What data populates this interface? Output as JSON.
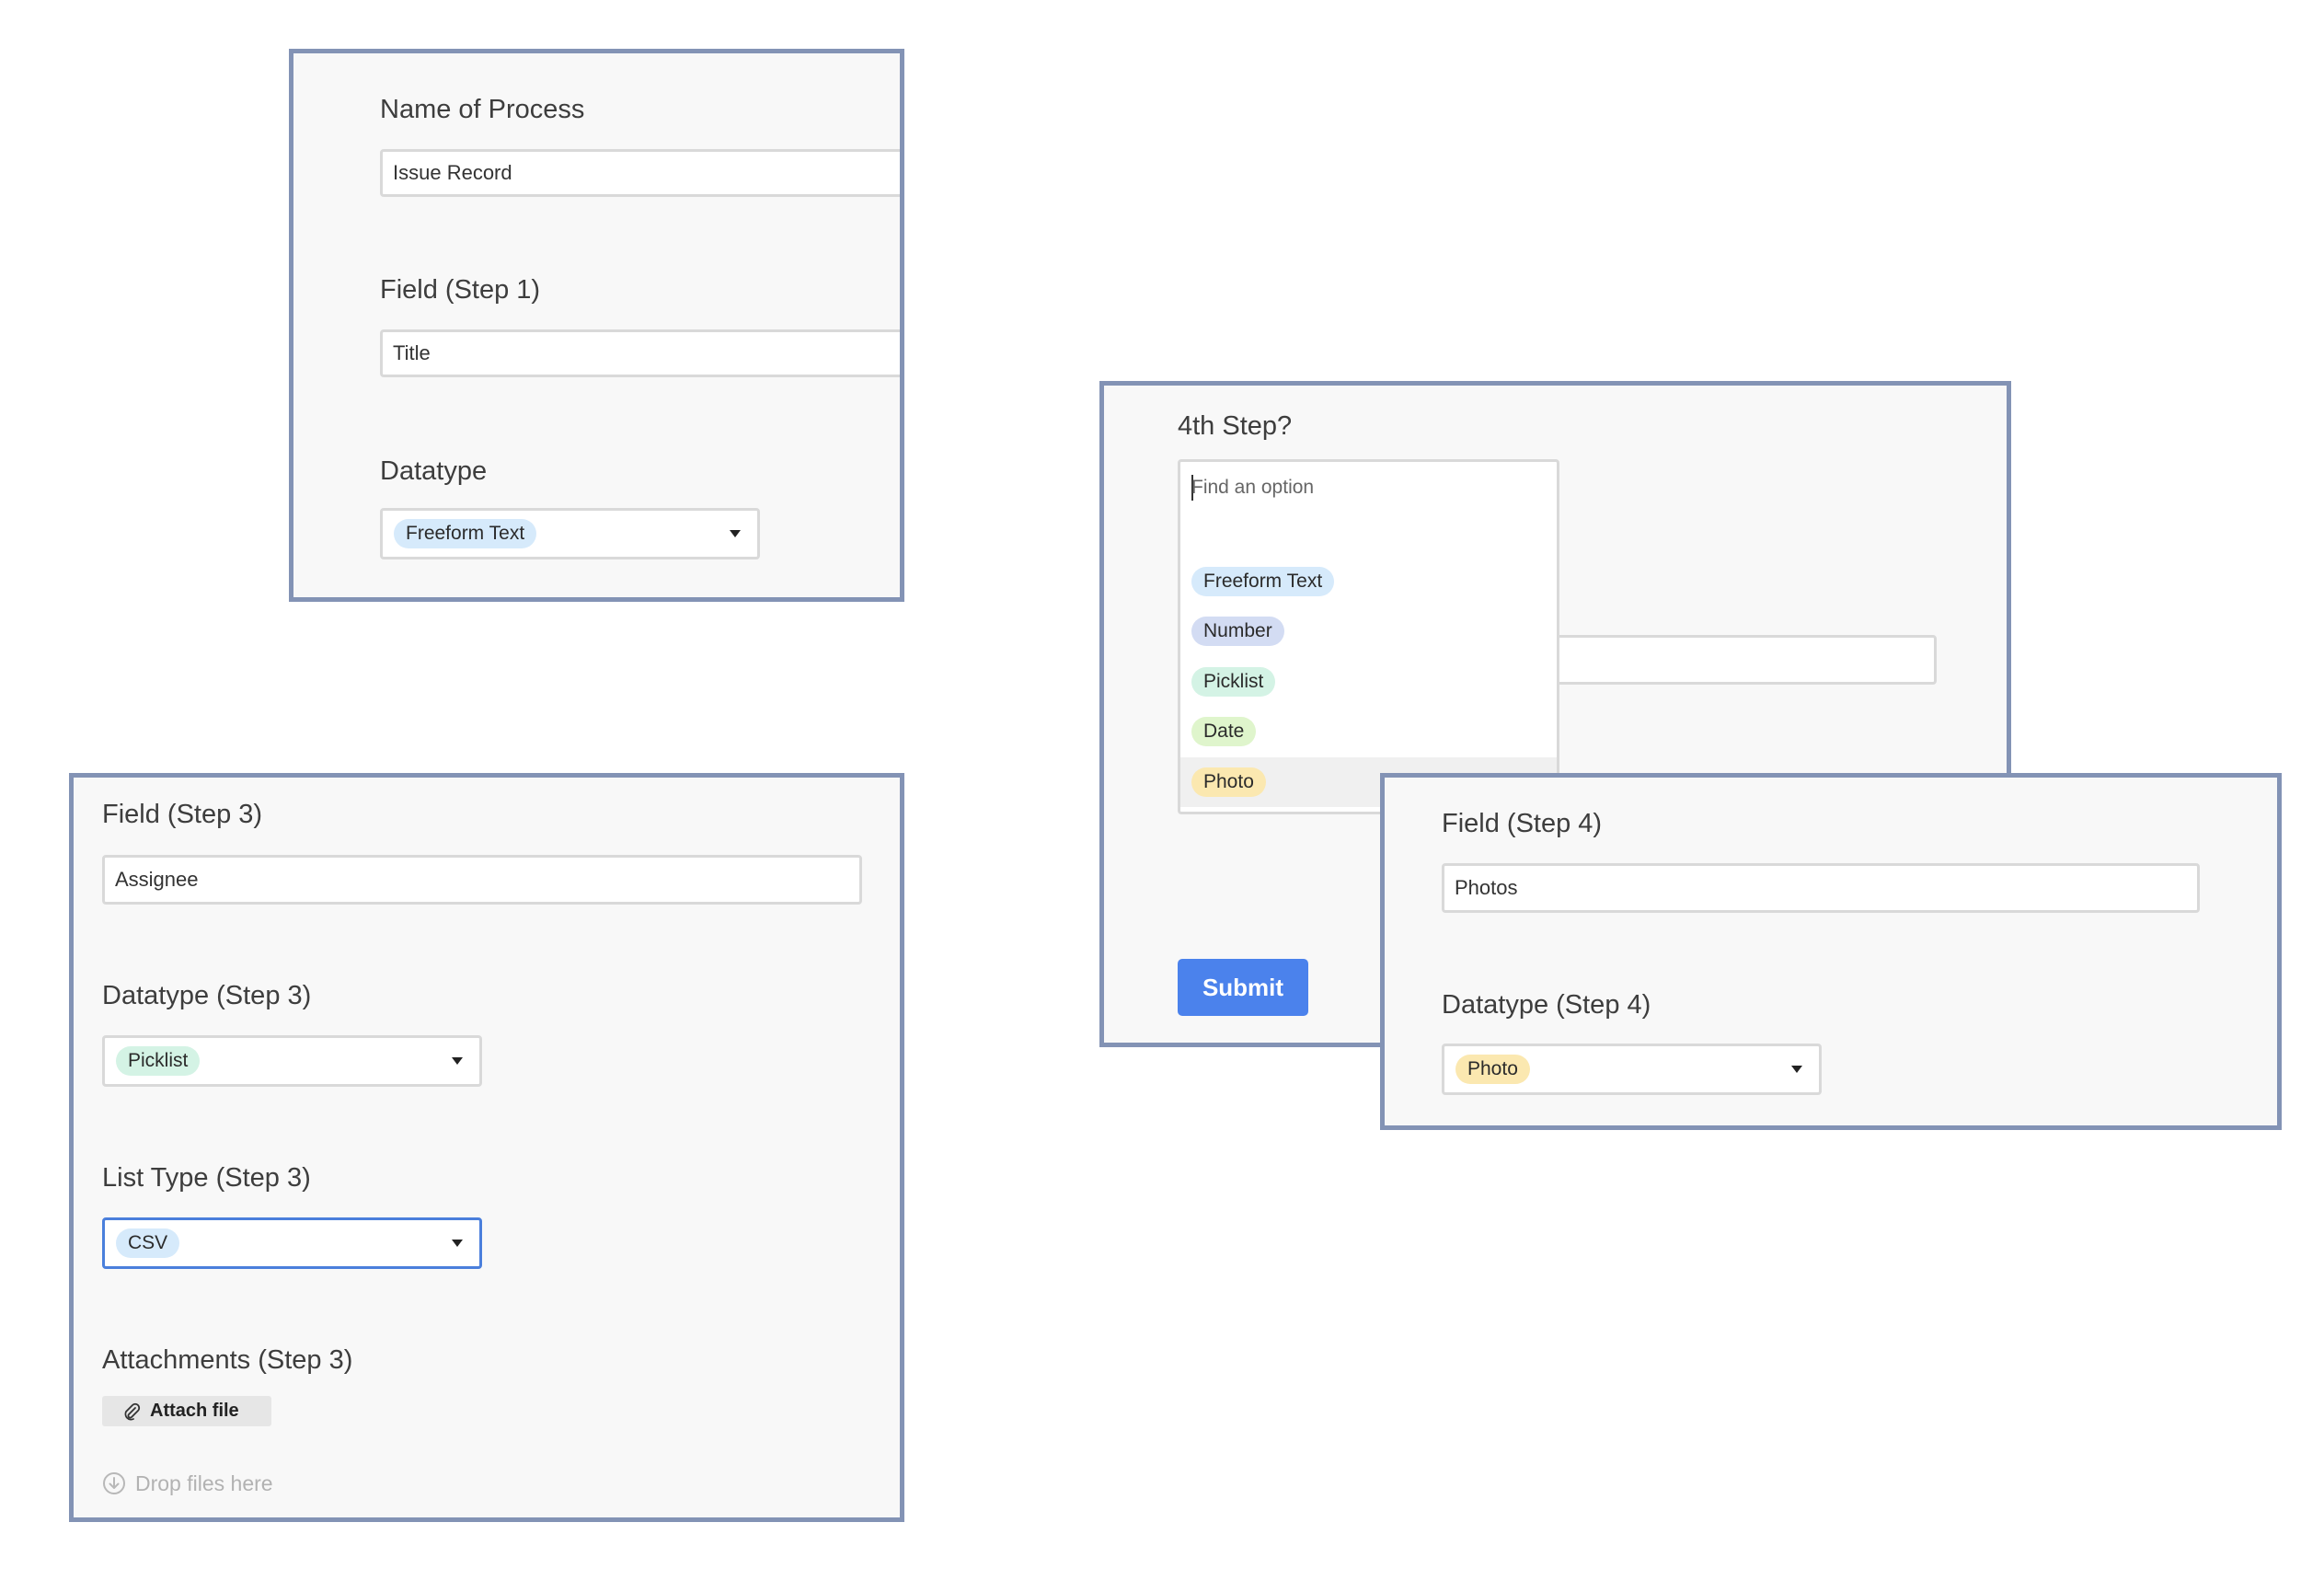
{
  "colors": {
    "panel_border": "#8393b5",
    "panel_background": "#f8f8f8",
    "submit_button": "#4b82ec",
    "focus_border": "#4a7fdc",
    "pill_freeform_text": "#d6eafb",
    "pill_number": "#d3dcf3",
    "pill_picklist": "#d4f3e5",
    "pill_date": "#dff5cc",
    "pill_photo": "#fbe8b0"
  },
  "panel_step1": {
    "process_name_label": "Name of Process",
    "process_name_value": "Issue Record",
    "field_label": "Field (Step 1)",
    "field_value": "Title",
    "datatype_label": "Datatype",
    "datatype_value": "Freeform Text"
  },
  "panel_step3": {
    "field_label": "Field (Step 3)",
    "field_value": "Assignee",
    "datatype_label": "Datatype (Step 3)",
    "datatype_value": "Picklist",
    "list_type_label": "List Type (Step 3)",
    "list_type_value": "CSV",
    "attachments_label": "Attachments (Step 3)",
    "attach_button_label": "Attach file",
    "drop_zone_text": "Drop files here"
  },
  "panel_4th_step": {
    "question_label": "4th Step?",
    "search_placeholder": "Find an option",
    "options": [
      {
        "label": "Freeform Text",
        "color": "#d6eafb"
      },
      {
        "label": "Number",
        "color": "#d3dcf3"
      },
      {
        "label": "Picklist",
        "color": "#d4f3e5"
      },
      {
        "label": "Date",
        "color": "#dff5cc"
      },
      {
        "label": "Photo",
        "color": "#fbe8b0"
      }
    ],
    "submit_label": "Submit"
  },
  "panel_step4": {
    "field_label": "Field (Step 4)",
    "field_value": "Photos",
    "datatype_label": "Datatype (Step 4)",
    "datatype_value": "Photo"
  },
  "icons": {
    "caret": "caret-down-icon",
    "paperclip": "paperclip-icon",
    "download": "download-icon"
  }
}
